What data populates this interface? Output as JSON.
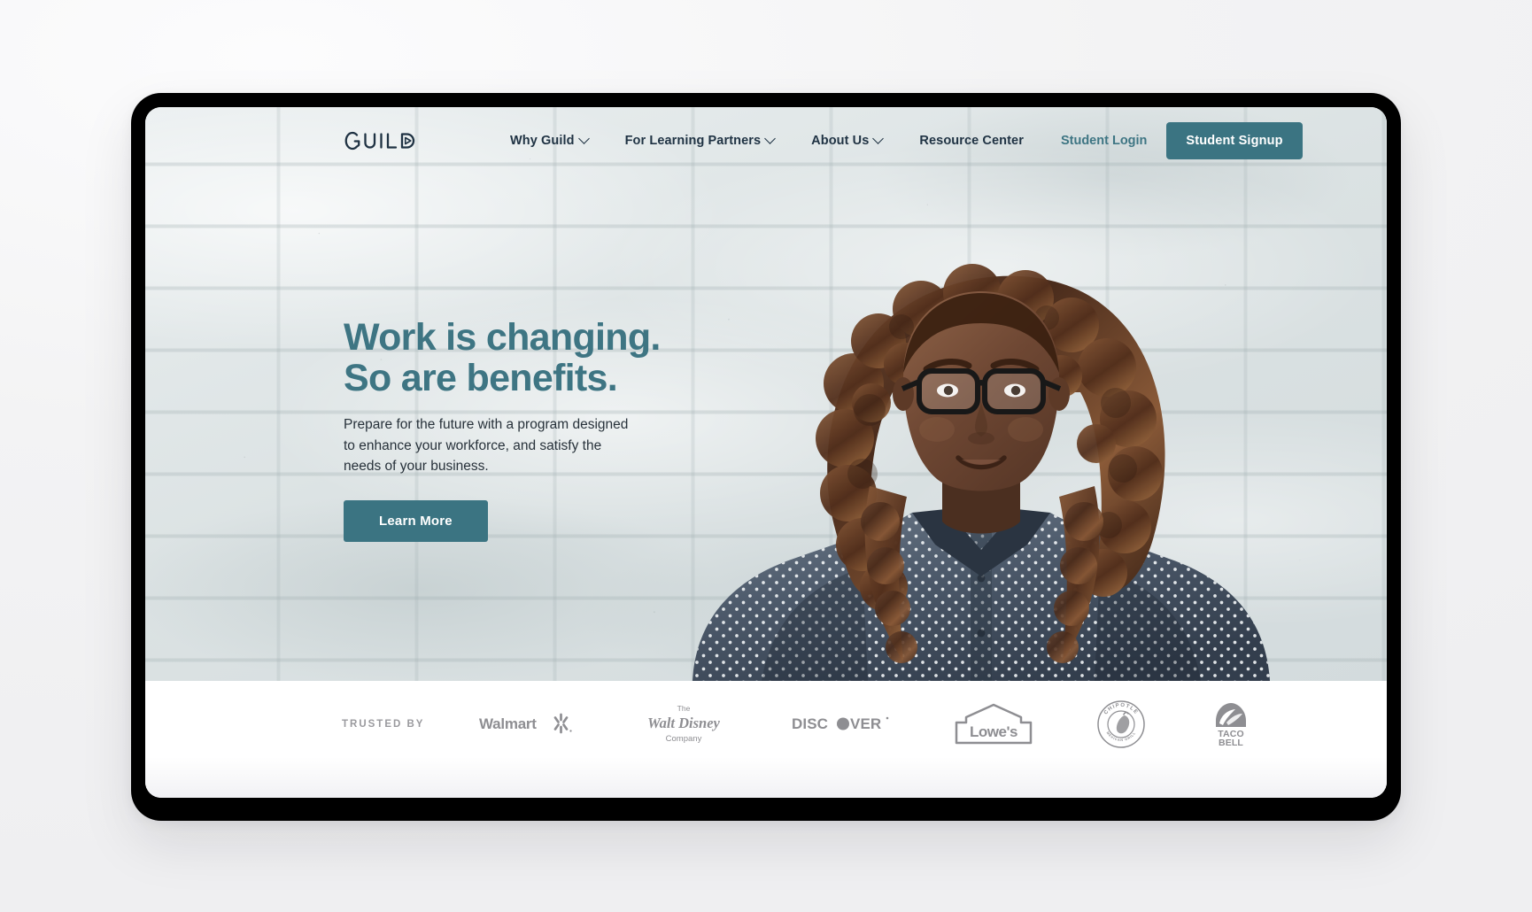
{
  "site": {
    "brand": "GUILD",
    "brand_icon": "guild-play-d-logomark"
  },
  "nav": {
    "items": [
      {
        "label": "Why Guild",
        "has_dropdown": true
      },
      {
        "label": "For Learning Partners",
        "has_dropdown": true
      },
      {
        "label": "About Us",
        "has_dropdown": true
      },
      {
        "label": "Resource Center",
        "has_dropdown": false
      }
    ],
    "login_label": "Student Login",
    "signup_label": "Student Signup"
  },
  "hero": {
    "headline_line1": "Work is changing.",
    "headline_line2": "So are benefits.",
    "subcopy": "Prepare for the future with a program designed to enhance your workforce, and satisfy the needs of your business.",
    "cta_label": "Learn More",
    "photo_alt": "Smiling woman with curly hair and glasses wearing a polka dot shirt, standing in front of a white painted brick wall"
  },
  "trusted": {
    "label": "TRUSTED BY",
    "logos": [
      {
        "name": "walmart",
        "text": "Walmart"
      },
      {
        "name": "walt-disney-company",
        "line1": "The",
        "line2": "Walt Disney",
        "line3": "Company"
      },
      {
        "name": "discover",
        "text": "DISCOVER"
      },
      {
        "name": "lowes",
        "text": "Lowe's"
      },
      {
        "name": "chipotle",
        "text": "CHIPOTLE",
        "sub": "MEXICAN GRILL"
      },
      {
        "name": "taco-bell",
        "line1": "TACO",
        "line2": "BELL"
      }
    ]
  },
  "colors": {
    "teal": "#3b7482",
    "teal_text": "#3e7583",
    "navy": "#1f3243",
    "body_text": "#27313a",
    "muted_gray": "#8e8e92",
    "label_gray": "#9a9a9e",
    "bezel": "#000000",
    "page_bg": "#f3f3f4",
    "wall": "#dde3e4"
  }
}
